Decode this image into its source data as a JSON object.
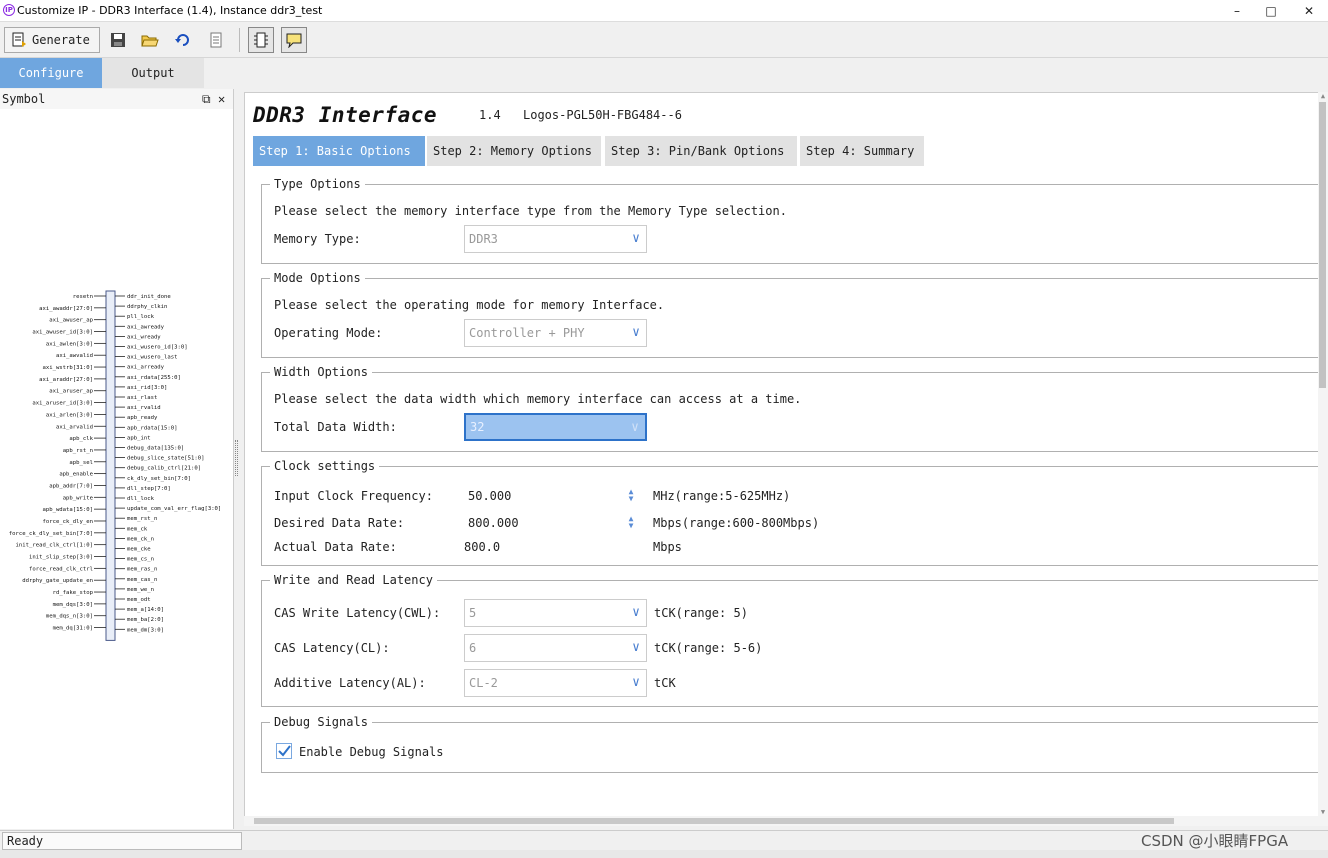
{
  "window": {
    "title": "Customize IP - DDR3 Interface (1.4), Instance ddr3_test",
    "app_icon": "IP",
    "controls": {
      "minimize": "–",
      "maximize": "□",
      "close": "✕"
    }
  },
  "toolbar": {
    "generate_label": "Generate",
    "icons": [
      "generate-icon",
      "save-icon",
      "open-folder-icon",
      "refresh-icon",
      "document-icon",
      "symbol-view-icon",
      "comment-icon"
    ]
  },
  "tabs": [
    {
      "label": "Configure",
      "active": true
    },
    {
      "label": "Output",
      "active": false
    }
  ],
  "symbol_panel": {
    "title": "Symbol",
    "restore": "⧉",
    "close": "✕",
    "left_ports": [
      "resetn",
      "axi_awaddr[27:0]",
      "axi_awuser_ap",
      "axi_awuser_id[3:0]",
      "axi_awlen[3:0]",
      "axi_awvalid",
      "axi_wstrb[31:0]",
      "axi_araddr[27:0]",
      "axi_aruser_ap",
      "axi_aruser_id[3:0]",
      "axi_arlen[3:0]",
      "axi_arvalid",
      "apb_clk",
      "apb_rst_n",
      "apb_sel",
      "apb_enable",
      "apb_addr[7:0]",
      "apb_write",
      "apb_wdata[15:0]",
      "force_ck_dly_en",
      "force_ck_dly_set_bin[7:0]",
      "init_read_clk_ctrl[1:0]",
      "init_slip_step[3:0]",
      "force_read_clk_ctrl",
      "ddrphy_gate_update_en",
      "rd_fake_stop",
      "mem_dqs[3:0]",
      "mem_dqs_n[3:0]",
      "mem_dq[31:0]"
    ],
    "right_ports": [
      "ddr_init_done",
      "ddrphy_clkin",
      "pll_lock",
      "axi_awready",
      "axi_wready",
      "axi_wusero_id[3:0]",
      "axi_wusero_last",
      "axi_arready",
      "axi_rdata[255:0]",
      "axi_rid[3:0]",
      "axi_rlast",
      "axi_rvalid",
      "apb_ready",
      "apb_rdata[15:0]",
      "apb_int",
      "debug_data[135:0]",
      "debug_slice_state[51:0]",
      "debug_calib_ctrl[21:0]",
      "ck_dly_set_bin[7:0]",
      "dll_step[7:0]",
      "dll_lock",
      "update_com_val_err_flag[3:0]",
      "mem_rst_n",
      "mem_ck",
      "mem_ck_n",
      "mem_cke",
      "mem_cs_n",
      "mem_ras_n",
      "mem_cas_n",
      "mem_we_n",
      "mem_odt",
      "mem_a[14:0]",
      "mem_ba[2:0]",
      "mem_dm[3:0]"
    ]
  },
  "ip": {
    "name": "DDR3 Interface",
    "version": "1.4",
    "device": "Logos-PGL50H-FBG484--6"
  },
  "steps": [
    {
      "label": "Step 1: Basic Options",
      "active": true
    },
    {
      "label": "Step 2: Memory Options",
      "active": false
    },
    {
      "label": "Step 3: Pin/Bank Options",
      "active": false
    },
    {
      "label": "Step 4: Summary",
      "active": false
    }
  ],
  "type_options": {
    "legend": "Type Options",
    "description": "Please select the memory interface type from the Memory Type selection.",
    "label": "Memory Type:",
    "value": "DDR3"
  },
  "mode_options": {
    "legend": "Mode Options",
    "description": "Please select the operating mode for memory Interface.",
    "label": "Operating Mode:",
    "value": "Controller + PHY"
  },
  "width_options": {
    "legend": "Width Options",
    "description": "Please select the data width which memory interface can access at a time.",
    "label": "Total Data Width:",
    "value": "32"
  },
  "clock_settings": {
    "legend": "Clock settings",
    "input_clock": {
      "label": "Input Clock Frequency:",
      "value": "50.000",
      "unit": "MHz(range:5-625MHz)"
    },
    "desired_rate": {
      "label": "Desired Data Rate:",
      "value": "800.000",
      "unit": "Mbps(range:600-800Mbps)"
    },
    "actual_rate": {
      "label": "Actual Data Rate:",
      "value": "800.0",
      "unit": "Mbps"
    }
  },
  "latency": {
    "legend": "Write and Read Latency",
    "cwl": {
      "label": "CAS Write Latency(CWL):",
      "value": "5",
      "unit": "tCK(range: 5)"
    },
    "cl": {
      "label": "CAS Latency(CL):",
      "value": "6",
      "unit": "tCK(range: 5-6)"
    },
    "al": {
      "label": "Additive Latency(AL):",
      "value": "CL-2",
      "unit": "tCK"
    }
  },
  "debug": {
    "legend": "Debug Signals",
    "checkbox_label": "Enable Debug Signals",
    "checked": true
  },
  "status": "Ready",
  "watermark": "CSDN @小眼睛FPGA"
}
